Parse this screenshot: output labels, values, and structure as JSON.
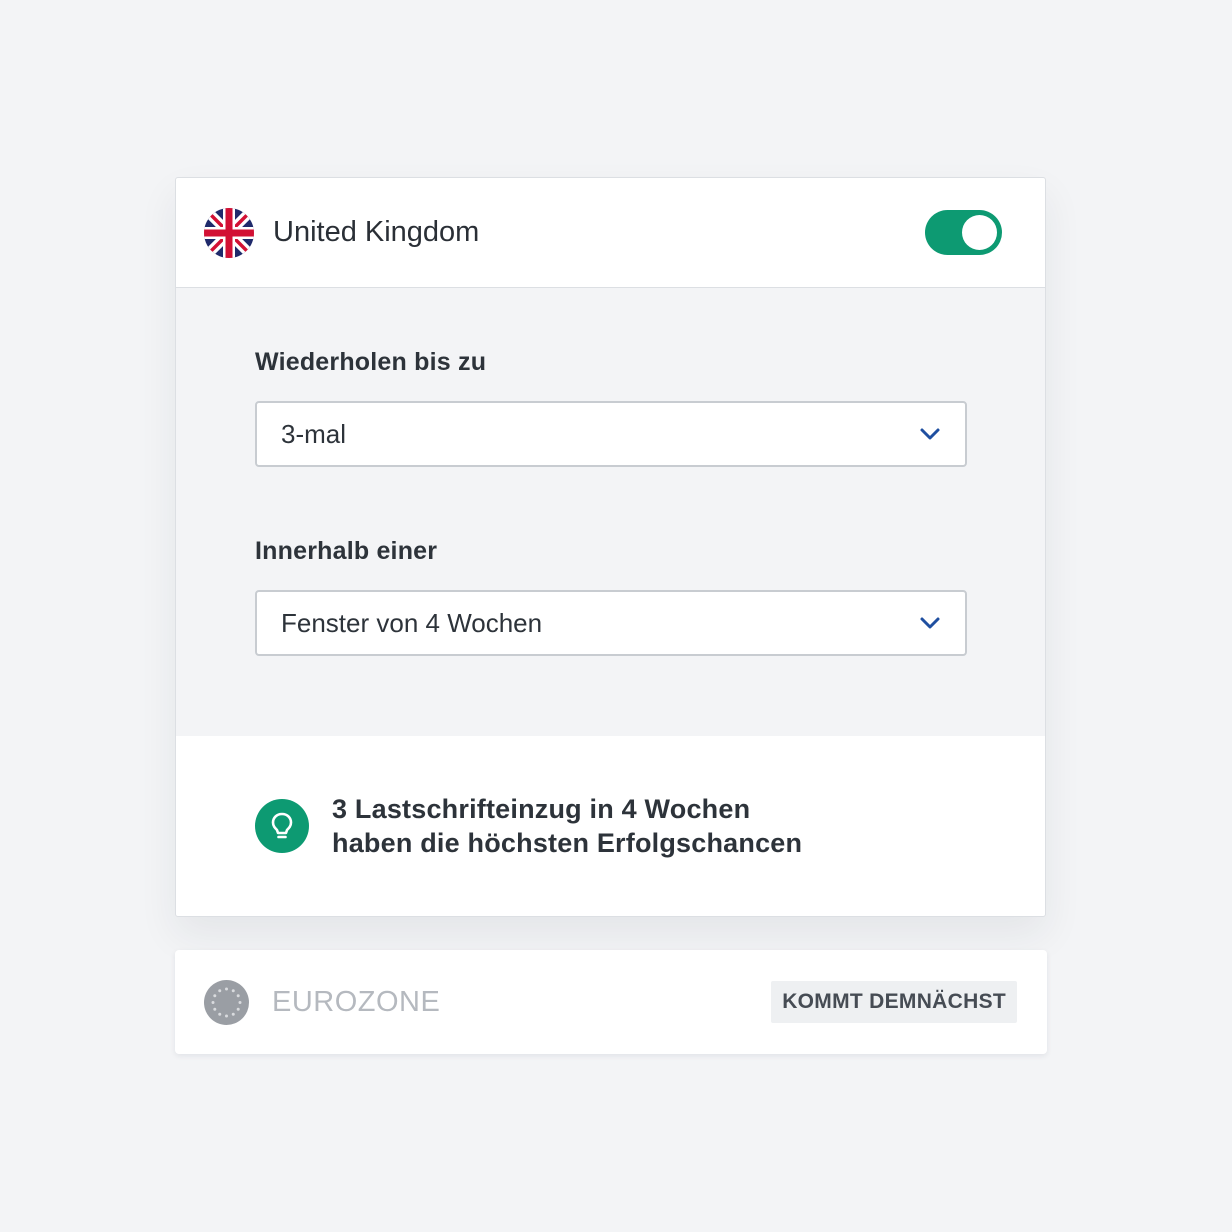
{
  "uk": {
    "country_name": "United Kingdom",
    "flag_icon": "uk-flag-icon",
    "enabled": true,
    "fields": {
      "retry_label": "Wiederholen bis zu",
      "retry_value": "3-mal",
      "window_label": "Innerhalb einer",
      "window_value": "Fenster von 4 Wochen"
    },
    "tip": {
      "icon": "lightbulb-icon",
      "line1": "3 Lastschrifteinzug in 4 Wochen",
      "line2": "haben die höchsten Erfolgschancen"
    }
  },
  "eurozone": {
    "name": "EUROZONE",
    "flag_icon": "eu-flag-icon",
    "badge": "KOMMT DEMNÄCHST"
  },
  "colors": {
    "accent_green": "#0d9a72",
    "chevron_blue": "#1f4fa0",
    "background": "#f3f4f6",
    "muted_text": "#b5b9bf"
  }
}
